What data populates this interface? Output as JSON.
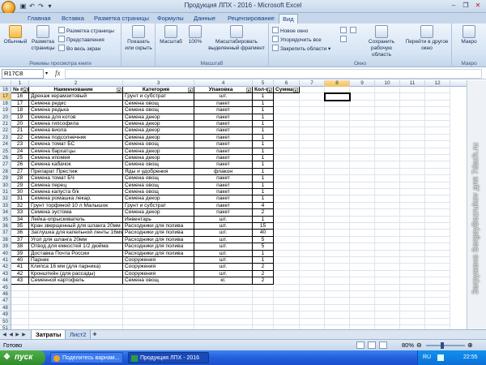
{
  "window": {
    "title": "Продукция ЛПХ - 2016 - Microsoft Excel"
  },
  "tabs": [
    "Главная",
    "Вставка",
    "Разметка страницы",
    "Формулы",
    "Данные",
    "Рецензирование",
    "Вид"
  ],
  "active_tab": "Вид",
  "ribbon": {
    "normal": "Обычный",
    "page_layout": "Разметка страницы",
    "page_break": "Разметка страницы",
    "custom_views": "Представления",
    "full_screen": "Во весь экран",
    "group_views": "Режимы просмотра книги",
    "show_hide": "Показать или скрыть",
    "zoom": "Масштаб",
    "zoom_100": "100%",
    "zoom_sel": "Масштабировать выделенный фрагмент",
    "group_zoom": "Масштаб",
    "new_window": "Новое окно",
    "arrange_all": "Упорядочить все",
    "freeze": "Закрепить области",
    "save_ws": "Сохранить рабочую область",
    "switch": "Перейти в другое окно",
    "group_window": "Окно",
    "macros": "Макро",
    "group_macros": "Макро"
  },
  "formula_bar": {
    "name_box": "R17C8",
    "fx": "fx",
    "value": ""
  },
  "columns": [
    "1",
    "2",
    "3",
    "4",
    "5",
    "6",
    "7",
    "8",
    "9",
    "10",
    "11",
    "12"
  ],
  "selected_column": "8",
  "table_headers": [
    "№ п/п",
    "Наименование",
    "Категория",
    "Упаковка",
    "Кол-во",
    "Сумма"
  ],
  "rows": [
    {
      "row": "16",
      "cells": [
        "№ п/п",
        "Наименование",
        "Категория",
        "Упаковка",
        "Кол-во",
        "Сумма"
      ],
      "header": true
    },
    {
      "row": "17",
      "cells": [
        "16",
        "Дренаж керамзитовый",
        "Грунт и субстрат",
        "шт.",
        "1"
      ]
    },
    {
      "row": "18",
      "cells": [
        "17",
        "Семена редис",
        "Семена овощ",
        "пакет",
        "1"
      ]
    },
    {
      "row": "19",
      "cells": [
        "18",
        "Семена редька",
        "Семена овощ",
        "пакет",
        "1"
      ]
    },
    {
      "row": "20",
      "cells": [
        "19",
        "Семена для котов",
        "Семена декор",
        "пакет",
        "1"
      ]
    },
    {
      "row": "21",
      "cells": [
        "20",
        "Семена гипсофила",
        "Семена декор",
        "пакет",
        "1"
      ]
    },
    {
      "row": "22",
      "cells": [
        "21",
        "Семена виола",
        "Семена декор",
        "пакет",
        "1"
      ]
    },
    {
      "row": "23",
      "cells": [
        "22",
        "Семена подсолнечник",
        "Семена декор",
        "пакет",
        "1"
      ]
    },
    {
      "row": "24",
      "cells": [
        "23",
        "Семена томат БС",
        "Семена овощ",
        "пакет",
        "1"
      ]
    },
    {
      "row": "25",
      "cells": [
        "24",
        "Семена бархатцы",
        "Семена декор",
        "пакет",
        "1"
      ]
    },
    {
      "row": "26",
      "cells": [
        "25",
        "Семена ипомея",
        "Семена декор",
        "пакет",
        "1"
      ]
    },
    {
      "row": "27",
      "cells": [
        "26",
        "Семена кабачок",
        "Семена овощ",
        "пакет",
        "1"
      ]
    },
    {
      "row": "28",
      "cells": [
        "27",
        "Препарат Престиж",
        "Яды и удобрения",
        "флакон",
        "1"
      ]
    },
    {
      "row": "29",
      "cells": [
        "28",
        "Семена томат БЧ",
        "Семена овощ",
        "пакет",
        "1"
      ]
    },
    {
      "row": "30",
      "cells": [
        "29",
        "Семена перец",
        "Семена овощ",
        "пакет",
        "1"
      ]
    },
    {
      "row": "31",
      "cells": [
        "30",
        "Семена капуста б/к",
        "Семена овощ",
        "пакет",
        "1"
      ]
    },
    {
      "row": "32",
      "cells": [
        "31",
        "Семена ромашка лекар.",
        "Семена декор",
        "пакет",
        "1"
      ]
    },
    {
      "row": "33",
      "cells": [
        "32",
        "Грунт торфяной 10 л Малышок",
        "Грунт и субстрат",
        "пакет",
        "4"
      ]
    },
    {
      "row": "34",
      "cells": [
        "33",
        "Семена эустома",
        "Семена декор",
        "пакет",
        "2"
      ]
    },
    {
      "row": "35",
      "cells": [
        "34",
        "Лейка-опрыскиватель",
        "Инвентарь",
        "шт.",
        "1"
      ]
    },
    {
      "row": "36",
      "cells": [
        "35",
        "Кран зверщенный для шланга 20мм",
        "Расходники для полива",
        "шт.",
        "15"
      ]
    },
    {
      "row": "37",
      "cells": [
        "36",
        "Заглушка для капельной ленты 16мм",
        "Расходники для полива",
        "шт.",
        "40"
      ]
    },
    {
      "row": "38",
      "cells": [
        "37",
        "Угол для шланга 20мм",
        "Расходники для полива",
        "шт.",
        "5"
      ]
    },
    {
      "row": "39",
      "cells": [
        "38",
        "Отвод для емкостей 1/2 дюйма",
        "Расходники для полива",
        "шт.",
        "5"
      ]
    },
    {
      "row": "40",
      "cells": [
        "39",
        "Доставка Почта России",
        "Расходники для полива",
        "шт.",
        "1"
      ]
    },
    {
      "row": "41",
      "cells": [
        "40",
        "Парник",
        "Сооружения",
        "шт.",
        "1"
      ]
    },
    {
      "row": "42",
      "cells": [
        "41",
        "Клипса 16 мм (для парника)",
        "Сооружения",
        "шт.",
        "2"
      ]
    },
    {
      "row": "43",
      "cells": [
        "42",
        "Кронштейн (для рассады)",
        "Сооружения",
        "шт.",
        "2"
      ]
    },
    {
      "row": "44",
      "cells": [
        "43",
        "Семенной картофель",
        "Семена овощ",
        "кг.",
        "2"
      ]
    },
    {
      "row": "45",
      "cells": []
    },
    {
      "row": "46",
      "cells": []
    },
    {
      "row": "47",
      "cells": []
    },
    {
      "row": "48",
      "cells": []
    },
    {
      "row": "49",
      "cells": []
    },
    {
      "row": "50",
      "cells": []
    },
    {
      "row": "51",
      "cells": []
    }
  ],
  "sheets": [
    "Затраты",
    "Лист2"
  ],
  "active_sheet": "Затраты",
  "status": {
    "ready": "Готово",
    "zoom": "80%"
  },
  "taskbar": {
    "start": "пуск",
    "items": [
      "Поделитесь варнам...",
      "Продукция ЛПХ - 2016"
    ],
    "lang": "RU",
    "clock": "22:55"
  },
  "watermark": "Загружено SergeyBezrukov для 7dach.ru"
}
